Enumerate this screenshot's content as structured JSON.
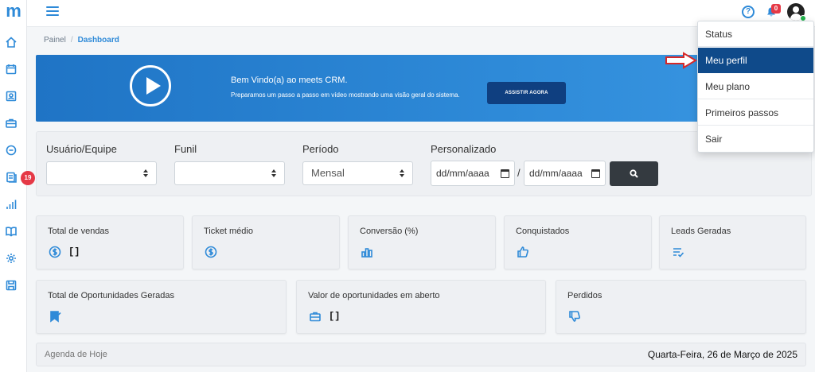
{
  "app": {
    "logo": "m"
  },
  "sidebar": {
    "items": [
      {
        "icon": "home-icon"
      },
      {
        "icon": "calendar-icon"
      },
      {
        "icon": "contacts-icon"
      },
      {
        "icon": "briefcase-icon"
      },
      {
        "icon": "chat-icon"
      },
      {
        "icon": "tasks-icon",
        "badge": "19"
      },
      {
        "icon": "bar-chart-icon"
      },
      {
        "icon": "book-icon"
      },
      {
        "icon": "gear-icon"
      },
      {
        "icon": "save-icon"
      }
    ]
  },
  "topbar": {
    "help": "?",
    "notifications_count": "0"
  },
  "breadcrumb": {
    "parent": "Painel",
    "separator": "/",
    "current": "Dashboard"
  },
  "banner": {
    "title": "Bem Vindo(a) ao meets CRM.",
    "subtitle": "Preparamos um passo a passo em vídeo mostrando uma visão geral do sistema.",
    "button": "ASSISTIR AGORA"
  },
  "filters": {
    "user_label": "Usuário/Equipe",
    "user_value": "",
    "funnel_label": "Funil",
    "funnel_value": "",
    "period_label": "Período",
    "period_value": "Mensal",
    "custom_label": "Personalizado",
    "date_start_placeholder": "dd/mm/aaaa",
    "date_end_placeholder": "dd/mm/aaaa",
    "date_separator": "/"
  },
  "cards_row1": [
    {
      "title": "Total de vendas",
      "icon": "dollar-icon",
      "value": "[]"
    },
    {
      "title": "Ticket médio",
      "icon": "dollar-icon",
      "value": ""
    },
    {
      "title": "Conversão (%)",
      "icon": "bar-chart-icon",
      "value": ""
    },
    {
      "title": "Conquistados",
      "icon": "thumbs-up-icon",
      "value": ""
    },
    {
      "title": "Leads Geradas",
      "icon": "list-check-icon",
      "value": ""
    }
  ],
  "cards_row2": [
    {
      "title": "Total de Oportunidades Geradas",
      "icon": "bookmark-icon",
      "value": ""
    },
    {
      "title": "Valor de oportunidades em aberto",
      "icon": "briefcase-icon",
      "value": "[]"
    },
    {
      "title": "Perdidos",
      "icon": "thumbs-down-icon",
      "value": ""
    }
  ],
  "agenda": {
    "title": "Agenda de Hoje",
    "date": "Quarta-Feira, 26 de Março de 2025"
  },
  "user_menu": {
    "items": [
      "Status",
      "Meu perfil",
      "Meu plano",
      "Primeiros passos",
      "Sair"
    ],
    "active_index": 1
  },
  "colors": {
    "accent": "#2e8ad8",
    "menu_active": "#0f4a8a",
    "badge": "#e53946",
    "arrow": "#d62828"
  }
}
